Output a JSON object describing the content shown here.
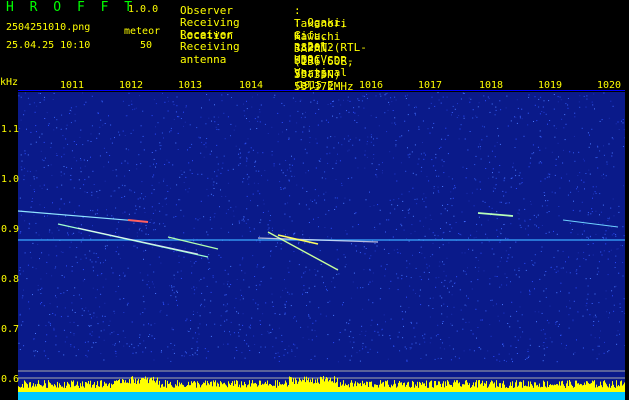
{
  "header": {
    "app_name": "H R O F F T",
    "version": "1.0.0",
    "file_name": "2504251010.png",
    "timestamp": "25.04.25 10:10",
    "meteor_label": "meteor",
    "meteor_count": "50"
  },
  "info": [
    {
      "key": "Observer",
      "value": ": Takanori Kawachi"
    },
    {
      "key": "Receiving Location",
      "value": ": Ogaki, Gifu, JAPAN (136.60E, 35.35N)"
    },
    {
      "key": "Receiver",
      "value": ": R820T2(RTL-SDR) SDR-Sharp 53.372MHz"
    },
    {
      "key": "Receiving antenna",
      "value": ": 2el-HB9CV Vertical (el. E-W)"
    }
  ],
  "axes": {
    "y_unit": "kHz",
    "y_ticks": [
      "1.1",
      "1.0",
      "0.9",
      "0.8",
      "0.7",
      "0.6"
    ],
    "x_ticks": [
      "1011",
      "1012",
      "1013",
      "1014",
      "1015",
      "1016",
      "1017",
      "1018",
      "1019",
      "1020"
    ]
  },
  "colors": {
    "background": "#000000",
    "spectrogram_bg": "#0a1a8a",
    "label": "#ffff00",
    "brand": "#00ff00",
    "header_value": "#ffffff",
    "activity": "#ffff00",
    "activity_base": "#00c8ff"
  }
}
